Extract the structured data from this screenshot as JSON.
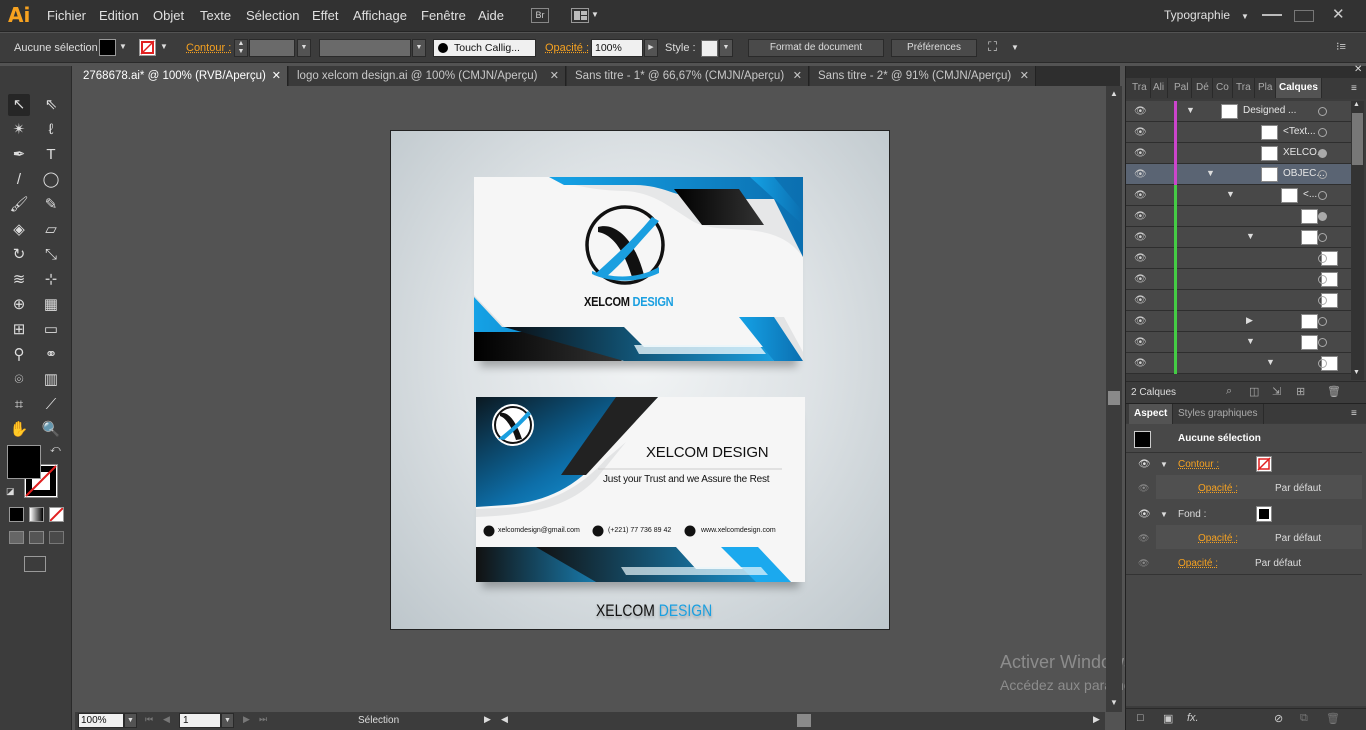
{
  "app": {
    "logo": "Ai"
  },
  "menu": [
    "Fichier",
    "Edition",
    "Objet",
    "Texte",
    "Sélection",
    "Effet",
    "Affichage",
    "Fenêtre",
    "Aide"
  ],
  "menu_badge": "Br",
  "workspace": "Typographie",
  "control_bar": {
    "selection": "Aucune sélection",
    "contour_label": "Contour :",
    "brush": "Touch Callig...",
    "opacity_label": "Opacité :",
    "opacity_value": "100%",
    "style_label": "Style :",
    "doc_format": "Format de document",
    "preferences": "Préférences"
  },
  "tabs": [
    "2768678.ai* @ 100% (RVB/Aperçu)",
    "logo xelcom design.ai @ 100% (CMJN/Aperçu)",
    "Sans titre - 1* @ 66,67% (CMJN/Aperçu)",
    "Sans titre - 2* @ 91% (CMJN/Aperçu)"
  ],
  "card1": {
    "brand_a": "XELCOM",
    "brand_b": "DESIGN"
  },
  "card2": {
    "title": "XELCOM DESIGN",
    "tagline": "Just your Trust and we Assure the Rest",
    "email": "xelcomdesign@gmail.com",
    "phone": "(+221) 77 736 89 42",
    "web": "www.xelcomdesign.com"
  },
  "footer_brand": {
    "a": "XELCOM",
    "b": "DESIGN"
  },
  "status": {
    "zoom": "100%",
    "page": "1",
    "tool": "Sélection"
  },
  "panel_tabs": [
    "Tra",
    "Ali",
    "Pal",
    "Dé",
    "Co",
    "Tra",
    "Pla",
    "Calques"
  ],
  "layers": [
    {
      "name": "Designed ...",
      "color": "#cc44cc",
      "arrow": "▼",
      "ring_filled": false,
      "highlight": false
    },
    {
      "name": "<Text...",
      "color": "#cc44cc",
      "arrow": "",
      "ring_filled": false,
      "highlight": false
    },
    {
      "name": "XELCO...",
      "color": "#cc44cc",
      "arrow": "",
      "ring_filled": true,
      "highlight": false
    },
    {
      "name": "OBJEC...",
      "color": "#cc44cc",
      "arrow": "▼",
      "ring_filled": false,
      "highlight": true
    },
    {
      "name": "<...",
      "color": "#44cc44",
      "arrow": "▼",
      "ring_filled": false,
      "highlight": false
    },
    {
      "name": "",
      "color": "#44cc44",
      "arrow": "",
      "ring_filled": true,
      "highlight": false
    },
    {
      "name": "",
      "color": "#44cc44",
      "arrow": "▼",
      "ring_filled": false,
      "highlight": false
    },
    {
      "name": "",
      "color": "#44cc44",
      "arrow": "",
      "ring_filled": false,
      "highlight": false
    },
    {
      "name": "",
      "color": "#44cc44",
      "arrow": "",
      "ring_filled": false,
      "highlight": false
    },
    {
      "name": "",
      "color": "#44cc44",
      "arrow": "",
      "ring_filled": false,
      "highlight": false
    },
    {
      "name": "",
      "color": "#44cc44",
      "arrow": "▶",
      "ring_filled": false,
      "highlight": false
    },
    {
      "name": "",
      "color": "#44cc44",
      "arrow": "▼",
      "ring_filled": false,
      "highlight": false
    },
    {
      "name": "",
      "color": "#44cc44",
      "arrow": "▼",
      "ring_filled": false,
      "highlight": false
    }
  ],
  "layers_count": "2 Calques",
  "aspect": {
    "tab": "Aspect",
    "tab2": "Styles graphiques",
    "title": "Aucune sélection",
    "contour": "Contour :",
    "opacite": "Opacité :",
    "par_defaut": "Par défaut",
    "fond": "Fond :"
  },
  "watermark": {
    "line1": "Activer Windows",
    "line2": "Accédez aux paramètres pour activer Windows."
  },
  "colors": {
    "accent": "#1a9fe0",
    "orange": "#f7a220"
  }
}
